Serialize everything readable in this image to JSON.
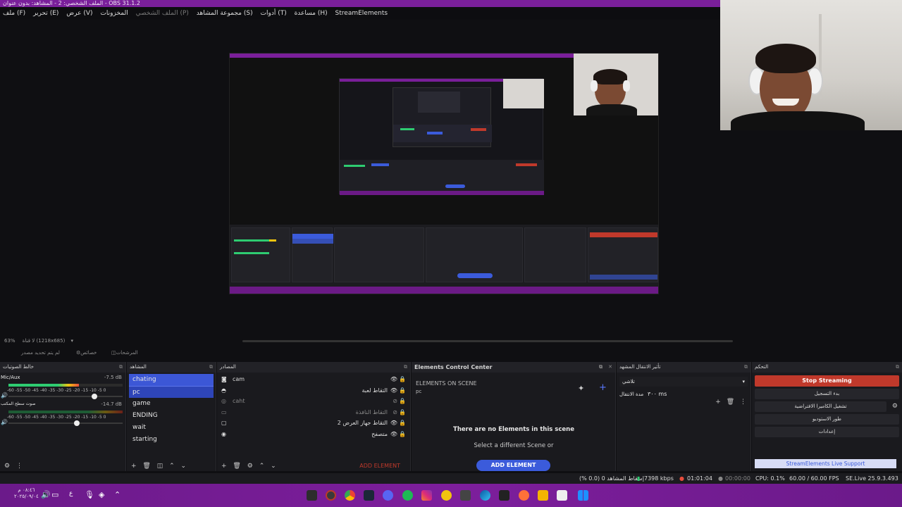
{
  "window": {
    "title": "الملف الشخصي: 2 - المشاهد: بدون عنوان - OBS 31.1.2"
  },
  "menubar": {
    "items": [
      "ملف (F)",
      "تحرير (E)",
      "عرض (V)",
      "المخزونات",
      "الملف الشخصي (P)",
      "مجموعة المشاهد (S)",
      "أدوات (T)",
      "مساعدة (H)",
      "StreamElements"
    ]
  },
  "preview": {
    "zoom": "63%",
    "canvas_size": "لا قناة (1218x685)",
    "tabs": [
      "لم يتم تحديد مصدر",
      "خصائص",
      "المرشحات"
    ]
  },
  "mixer": {
    "title": "خالط الصوتيات",
    "channels": [
      {
        "name": "Mic/Aux",
        "db": "-7.5 dB",
        "level": 0.62,
        "volume": 0.75
      },
      {
        "name": "صوت سطح المكتب",
        "db": "-14.7 dB",
        "level": 0.0,
        "volume": 0.6
      }
    ],
    "ticks": "-60 -55 -50 -45 -40 -35 -30 -25 -20 -15 -10 -5 0"
  },
  "scenes": {
    "title": "المشاهد",
    "items": [
      "chating",
      "pc",
      "game",
      "ENDING",
      "wait",
      "starting"
    ],
    "selected": "pc"
  },
  "sources": {
    "title": "المصادر",
    "items": [
      {
        "name": "cam",
        "visible": true
      },
      {
        "name": "التقاط لعبة",
        "visible": true
      },
      {
        "name": "caht",
        "visible": false
      },
      {
        "name": "التقاط النافذة",
        "visible": false
      },
      {
        "name": "التقاط جهاز العرض 2",
        "visible": true
      },
      {
        "name": "متصفح",
        "visible": true
      }
    ],
    "add_element": "ADD ELEMENT"
  },
  "elements": {
    "title": "Elements Control Center",
    "heading": "ELEMENTS ON SCENE",
    "scene": "pc",
    "empty_title": "There are no Elements in this scene",
    "empty_sub": "Select a different Scene or",
    "add_button": "ADD ELEMENT"
  },
  "transitions": {
    "title": "تأثير الانتقال المشهد",
    "selected": "تلاشي",
    "duration_label": "مدة الانتقال",
    "duration_value": "٣٠٠ ms"
  },
  "controls": {
    "title": "التحكم",
    "stop_streaming": "Stop Streaming",
    "start_recording": "بدء التسجيل",
    "virtual_camera": "تشغيل الكاميرا الافتراضية",
    "studio_mode": "طور الاستوديو",
    "settings": "إعدادات",
    "live_support": "StreamElements Live Support"
  },
  "status": {
    "dropped": "إسقاط المشاهد 0 (0.0 %)",
    "bitrate": "7398 kbps",
    "live_time": "01:01:04",
    "rec_time": "00:00:00",
    "cpu": "CPU: 0.1%",
    "fps": "60.00 / 60.00 FPS",
    "se_version": "SE.Live 25.9.3.493"
  },
  "taskbar": {
    "time": "٠٨:٤٦ م",
    "date": "٢٠٢٥/٠٩/٠٤",
    "lang": "ع"
  },
  "colors": {
    "accent_purple": "#7a1f9a",
    "selection_blue": "#3c57d6",
    "stop_red": "#c0392b"
  }
}
